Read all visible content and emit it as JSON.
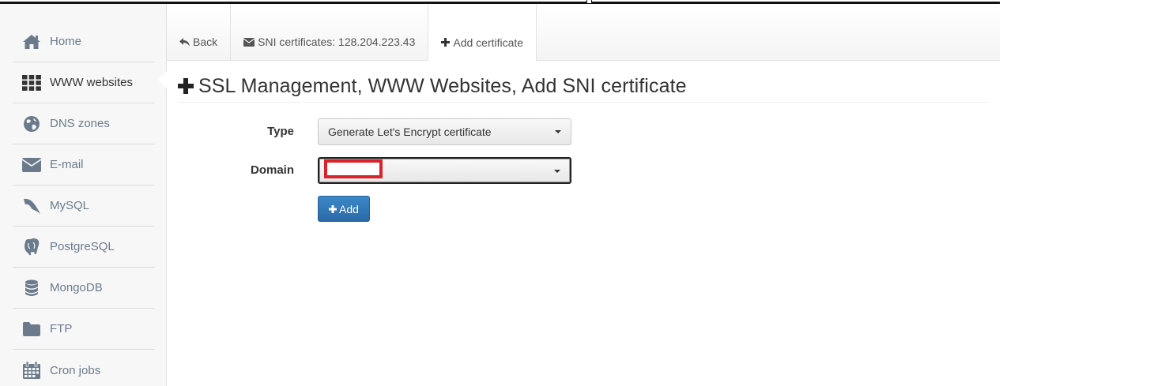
{
  "sidebar": {
    "items": [
      {
        "label": "Home",
        "icon": "home-icon"
      },
      {
        "label": "WWW websites",
        "icon": "grid-icon"
      },
      {
        "label": "DNS zones",
        "icon": "globe-icon"
      },
      {
        "label": "E-mail",
        "icon": "envelope-icon"
      },
      {
        "label": "MySQL",
        "icon": "dolphin-icon"
      },
      {
        "label": "PostgreSQL",
        "icon": "elephant-icon"
      },
      {
        "label": "MongoDB",
        "icon": "database-icon"
      },
      {
        "label": "FTP",
        "icon": "folder-icon"
      },
      {
        "label": "Cron jobs",
        "icon": "calendar-icon"
      }
    ],
    "active_index": 1
  },
  "tabs": [
    {
      "label": "Back",
      "icon": "reply-icon"
    },
    {
      "label": "SNI certificates: 128.204.223.43",
      "icon": "envelope-icon"
    },
    {
      "label": "Add certificate",
      "icon": "plus-icon"
    }
  ],
  "page": {
    "title": "SSL Management, WWW Websites, Add SNI certificate"
  },
  "form": {
    "type_label": "Type",
    "type_value": "Generate Let's Encrypt certificate",
    "domain_label": "Domain",
    "domain_value": "",
    "add_button": "Add"
  },
  "colors": {
    "primary_button": "#337ab7",
    "redaction": "#d9232b",
    "sidebar_bg": "#f7f7f7"
  }
}
